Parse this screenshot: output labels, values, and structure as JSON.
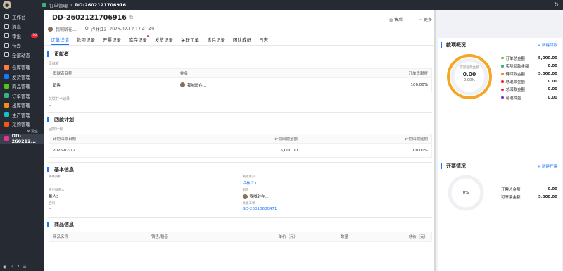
{
  "topbar": {
    "app_crumb": "订单管理",
    "page_crumb": "DD-2602121706916"
  },
  "sidebar": {
    "items": [
      {
        "label": "工作台",
        "icon": "home-icon"
      },
      {
        "label": "消息",
        "icon": "message-icon"
      },
      {
        "label": "审批",
        "icon": "approve-icon",
        "badge": "76"
      },
      {
        "label": "待办",
        "icon": "todo-icon"
      },
      {
        "label": "全部动态",
        "icon": "activity-icon"
      }
    ],
    "modules": [
      {
        "label": "仓库管理",
        "color": "#ff7a45"
      },
      {
        "label": "发货管理",
        "color": "#1677ff"
      },
      {
        "label": "商品管理",
        "color": "#52c41a"
      },
      {
        "label": "订单管理",
        "color": "#36b37e"
      },
      {
        "label": "出库管理",
        "color": "#fa8c16"
      },
      {
        "label": "生产管理",
        "color": "#13c2c2"
      },
      {
        "label": "采购管理",
        "color": "#fa541c"
      }
    ],
    "close_all": "⊗ 清空",
    "active_tab": "DD-260212..."
  },
  "header": {
    "title": "DD-2602121706916",
    "owner": "我喊龄在...",
    "customer": "卢林江3",
    "datetime": "2026-02-12 17:41:49",
    "after_sale": "售后",
    "more": "··· 更多"
  },
  "tabs": [
    "订单详情",
    "款项记录",
    "开票记录",
    "库存记录",
    "发货记录",
    "关联工单",
    "售后记录",
    "团队成员",
    "日志"
  ],
  "contributors": {
    "title": "贡献者",
    "sub_label": "贡献者",
    "headers": [
      "贡献者名称",
      "姓名",
      "订单贡献度"
    ],
    "row": {
      "name": "销售",
      "person": "我喊龄在...",
      "ratio": "100.00%"
    },
    "print_label": "关联打卡记录",
    "print_value": "--"
  },
  "payment_plan": {
    "title": "回款计划",
    "sub_label": "回款计划",
    "headers": [
      "计划回款日期",
      "计划回款金额",
      "计划回款比例"
    ],
    "row": {
      "date": "2026-02-12",
      "amount": "5,000.00",
      "ratio": "100.00%"
    }
  },
  "basic": {
    "title": "基本信息",
    "left": [
      {
        "k": "关联商机",
        "v": "--"
      },
      {
        "k": "客户联系人",
        "v": "戴人3"
      },
      {
        "k": "合同",
        "v": "--"
      }
    ],
    "right": [
      {
        "k": "关联客户",
        "v": "卢林江3",
        "link": true
      },
      {
        "k": "销售",
        "v": "我喊龄在...",
        "link": false
      },
      {
        "k": "关联工单",
        "v": "GD-26010600471",
        "link": true
      }
    ]
  },
  "products": {
    "title": "商品信息",
    "headers": [
      "商品名称",
      "销售/租借",
      "单价（元）",
      "数量",
      "总价（元）"
    ]
  },
  "funds": {
    "title": "款项概况",
    "new_label": "+ 新建回款",
    "ring_label": "实际回款金额",
    "ring_value": "0.00",
    "ring_pct": "0.00%",
    "legend": [
      {
        "label": "订单总金额",
        "value": "5,000.00",
        "color": "#52c41a"
      },
      {
        "label": "实际回款金额",
        "value": "0.00",
        "color": "#36b37e"
      },
      {
        "label": "待回款金额",
        "value": "5,000.00",
        "color": "#fa8c16"
      },
      {
        "label": "总退款金额",
        "value": "0.00",
        "color": "#f5222d"
      },
      {
        "label": "总回款金额",
        "value": "0.00",
        "color": "#f5222d"
      },
      {
        "label": "可退押金",
        "value": "0.00",
        "color": "#722ed1"
      }
    ]
  },
  "invoice": {
    "title": "开票情况",
    "new_label": "+ 新建开票",
    "ring_pct": "0%",
    "rows": [
      {
        "label": "开票总金额",
        "value": "0.00"
      },
      {
        "label": "可开票金额",
        "value": "5,000.00"
      }
    ]
  }
}
